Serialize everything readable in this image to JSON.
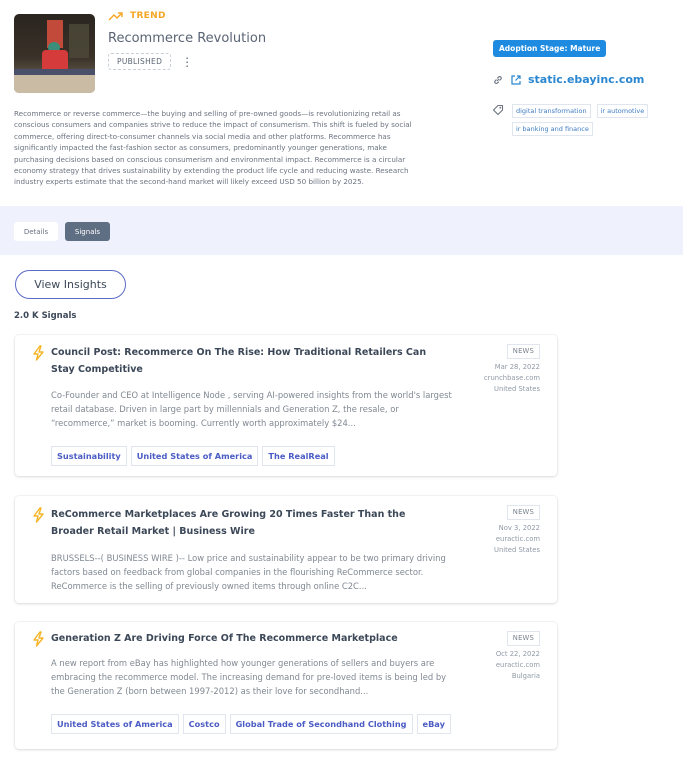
{
  "header": {
    "type_label": "TREND",
    "title": "Recommerce Revolution",
    "status": "PUBLISHED",
    "menu_glyph": "⋮",
    "description": "Recommerce or reverse commerce—the buying and selling of pre-owned goods—is revolutionizing retail as conscious consumers and companies strive to reduce the impact of consumerism. This shift is fueled by social commerce, offering direct-to-consumer channels via social media and other platforms. Recommerce has significantly impacted the fast-fashion sector as consumers, predominantly younger generations, make purchasing decisions based on conscious consumerism and environmental impact. Recommerce is a circular economy strategy that drives sustainability by extending the product life cycle and reducing waste. Research industry experts estimate that the second-hand market will likely exceed USD 50 billion by 2025.",
    "adoption_stage": "Adoption Stage: Mature",
    "source_link": "static.ebayinc.com",
    "tags": [
      "digital transformation",
      "ir automotive",
      "ir banking and finance"
    ]
  },
  "tabs": [
    {
      "label": "Details",
      "active": false
    },
    {
      "label": "Signals",
      "active": true
    }
  ],
  "actions": {
    "view_insights": "View Insights"
  },
  "signals_count": "2.0 K Signals",
  "signals": [
    {
      "title": "Council Post: Recommerce On The Rise: How Traditional Retailers Can Stay Competitive",
      "body": "Co-Founder and CEO at Intelligence Node , serving AI-powered insights from the world's largest retail database. Driven in large part by millennials and Generation Z, the resale, or “recommerce,” market is booming. Currently worth approximately $24...",
      "type": "NEWS",
      "date": "Mar 28, 2022",
      "source": "crunchbase.com",
      "country": "United States",
      "chips": [
        "Sustainability",
        "United States of America",
        "The RealReal"
      ]
    },
    {
      "title": "ReCommerce Marketplaces Are Growing 20 Times Faster Than the Broader Retail Market | Business Wire",
      "body": "BRUSSELS--( BUSINESS WIRE )-- Low price and sustainability appear to be two primary driving factors based on feedback from global companies in the flourishing ReCommerce sector. ReCommerce is the selling of previously owned items through online C2C...",
      "type": "NEWS",
      "date": "Nov 3, 2022",
      "source": "euractic.com",
      "country": "United States",
      "chips": []
    },
    {
      "title": "Generation Z Are Driving Force Of The Recommerce Marketplace",
      "body": "A new report from eBay has highlighted how younger generations of sellers and buyers are embracing the recommerce model. The increasing demand for pre-loved items is being led by the Generation Z (born between 1997-2012) as their love for secondhand...",
      "type": "NEWS",
      "date": "Oct 22, 2022",
      "source": "euractic.com",
      "country": "Bulgaria",
      "chips": [
        "United States of America",
        "Costco",
        "Global Trade of Secondhand Clothing",
        "eBay"
      ]
    }
  ],
  "colors": {
    "trend_accent": "#f5a623",
    "adoption_badge": "#1f8be0",
    "link": "#2a87d0",
    "active_tab": "#5e6f83",
    "tab_band": "#eff2fc",
    "chip_text": "#4b5cc4",
    "insights_border": "#5b6cc7"
  }
}
